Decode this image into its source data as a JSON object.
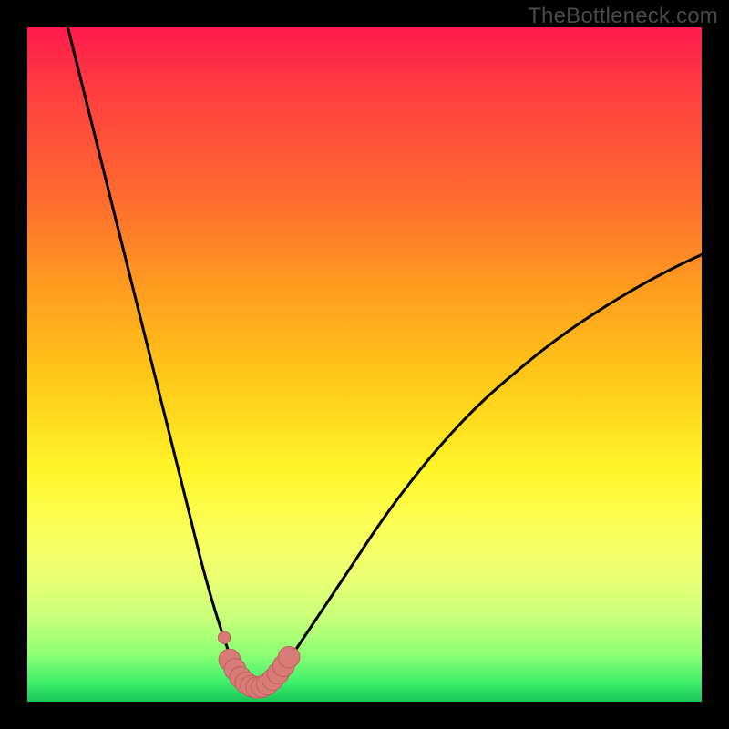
{
  "watermark": "TheBottleneck.com",
  "colors": {
    "frame": "#000000",
    "gradient_top": "#ff1a4d",
    "gradient_bottom": "#18c758",
    "curve_stroke": "#000000",
    "marker_fill": "#d87b78",
    "marker_stroke": "#c25f5c"
  },
  "chart_data": {
    "type": "line",
    "title": "",
    "xlabel": "",
    "ylabel": "",
    "xlim": [
      0,
      100
    ],
    "ylim": [
      0,
      100
    ],
    "grid": false,
    "legend": false,
    "series": [
      {
        "name": "bottleneck-curve",
        "x": [
          6,
          8,
          10,
          12,
          14,
          16,
          18,
          20,
          22,
          24,
          26,
          28,
          30,
          31,
          32,
          33,
          34,
          35,
          36,
          38,
          40,
          44,
          48,
          52,
          56,
          60,
          64,
          68,
          72,
          76,
          80,
          84,
          88,
          92,
          96,
          100
        ],
        "values": [
          100,
          92,
          84,
          76,
          68,
          60,
          52,
          44,
          36,
          28,
          20,
          13,
          7,
          4.5,
          3,
          2.2,
          2,
          2.2,
          3,
          5,
          8,
          14,
          20,
          26,
          31.5,
          36.5,
          41,
          45,
          48.5,
          51.8,
          54.8,
          57.5,
          60,
          62.3,
          64.4,
          66.3
        ]
      }
    ],
    "markers": [
      {
        "x": 29.2,
        "y": 9.5,
        "r": 0.9
      },
      {
        "x": 30.0,
        "y": 6.2,
        "r": 1.6
      },
      {
        "x": 30.8,
        "y": 4.8,
        "r": 1.6
      },
      {
        "x": 31.6,
        "y": 3.6,
        "r": 1.6
      },
      {
        "x": 32.4,
        "y": 2.8,
        "r": 1.6
      },
      {
        "x": 33.2,
        "y": 2.3,
        "r": 1.6
      },
      {
        "x": 34.0,
        "y": 2.1,
        "r": 1.6
      },
      {
        "x": 34.8,
        "y": 2.2,
        "r": 1.6
      },
      {
        "x": 35.6,
        "y": 2.6,
        "r": 1.6
      },
      {
        "x": 36.4,
        "y": 3.3,
        "r": 1.6
      },
      {
        "x": 37.2,
        "y": 4.2,
        "r": 1.6
      },
      {
        "x": 38.0,
        "y": 5.3,
        "r": 1.6
      },
      {
        "x": 38.8,
        "y": 6.6,
        "r": 1.6
      }
    ]
  }
}
